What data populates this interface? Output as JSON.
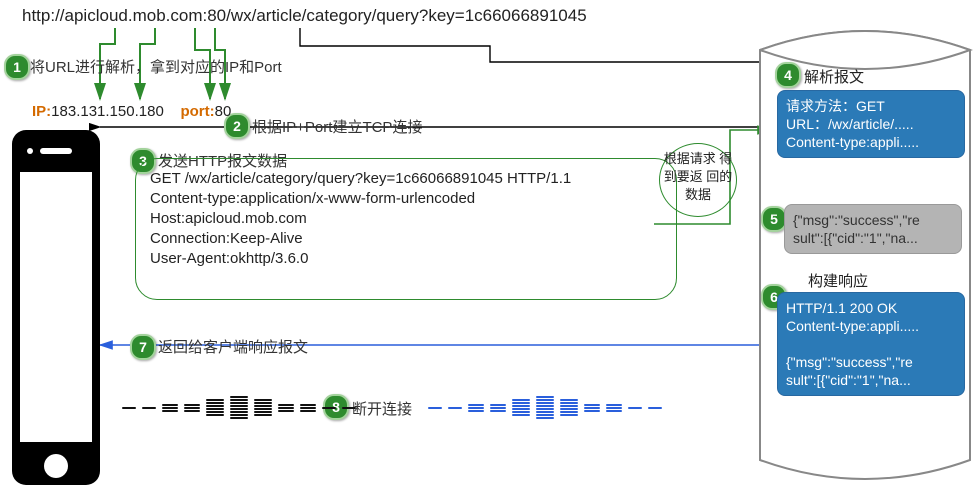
{
  "url": "http://apicloud.mob.com:80/wx/article/category/query?key=1c66066891045",
  "parse": {
    "ip_label": "IP:",
    "ip": "183.131.150.180",
    "port_label": "port:",
    "port": "80"
  },
  "steps": {
    "1": "将URL进行解析，拿到对应的IP和Port",
    "2": "根据IP+Port建立TCP连接",
    "3": "发送HTTP报文数据",
    "4": "解析报文",
    "5_note": "根据请求\n得到要返\n回的数据",
    "6": "构建响应",
    "7": "返回给客户端响应报文",
    "8": "断开连接"
  },
  "http_request": [
    "GET /wx/article/category/query?key=1c66066891045 HTTP/1.1",
    "Content-type:application/x-www-form-urlencoded",
    "Host:apicloud.mob.com",
    "Connection:Keep-Alive",
    "User-Agent:okhttp/3.6.0"
  ],
  "server": {
    "parsed": [
      "请求方法：GET",
      "URL：/wx/article/.....",
      "Content-type:appli....."
    ],
    "db_result": "{\"msg\":\"success\",\"re\nsult\":[{\"cid\":\"1\",\"na...",
    "response": [
      "HTTP/1.1 200 OK",
      "Content-type:appli.....",
      "",
      "{\"msg\":\"success\",\"re",
      "sult\":[{\"cid\":\"1\",\"na..."
    ]
  },
  "colors": {
    "green": "#2e8b2e",
    "blue": "#2b7ab7",
    "orange": "#d46a00",
    "link": "#2a5fdc"
  }
}
